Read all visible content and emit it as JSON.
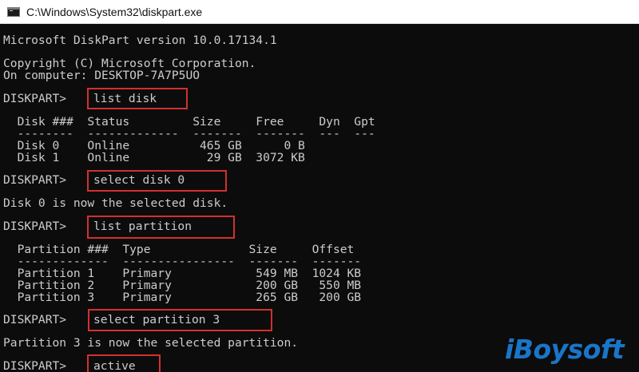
{
  "window": {
    "title": "C:\\Windows\\System32\\diskpart.exe",
    "icon": "cmd-icon"
  },
  "console": {
    "version_line": "Microsoft DiskPart version 10.0.17134.1",
    "copyright_line": "Copyright (C) Microsoft Corporation.",
    "computer_line": "On computer: DESKTOP-7A7P5UO",
    "prompt": "DISKPART>",
    "cmd_list_disk": "list disk",
    "disk_header": "  Disk ###  Status         Size     Free     Dyn  Gpt",
    "disk_sep": "  --------  -------------  -------  -------  ---  ---",
    "disk_rows": [
      "  Disk 0    Online          465 GB      0 B",
      "  Disk 1    Online           29 GB  3072 KB"
    ],
    "cmd_select_disk": "select disk 0",
    "select_disk_result": "Disk 0 is now the selected disk.",
    "cmd_list_partition": "list partition",
    "part_header": "  Partition ###  Type              Size     Offset",
    "part_sep": "  -------------  ----------------  -------  -------",
    "part_rows": [
      "  Partition 1    Primary            549 MB  1024 KB",
      "  Partition 2    Primary            200 GB   550 MB",
      "  Partition 3    Primary            265 GB   200 GB"
    ],
    "cmd_select_partition": "select partition 3",
    "select_partition_result": "Partition 3 is now the selected partition.",
    "cmd_active": "active"
  },
  "watermark": "iBoysoft",
  "colors": {
    "console_bg": "#0c0c0c",
    "console_text": "#cccccc",
    "highlight_box": "#d23030",
    "watermark": "#1a75c8"
  }
}
